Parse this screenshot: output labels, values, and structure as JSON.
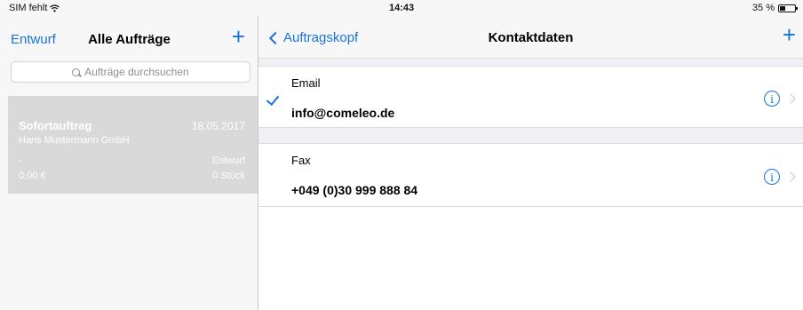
{
  "status_bar": {
    "carrier": "SIM fehlt",
    "time": "14:43",
    "battery": "35 %",
    "battery_level": 0.35
  },
  "left": {
    "back_label": "Entwurf",
    "title": "Alle Aufträge",
    "add_label": "+",
    "search_placeholder": "Aufträge durchsuchen",
    "orders": [
      {
        "name": "Sofortauftrag",
        "date": "18.05.2017",
        "company": "Hans Mustermann GmbH",
        "dash": "-",
        "status": "Entwurf",
        "price": "0,00 €",
        "quantity": "0 Stück"
      }
    ]
  },
  "right": {
    "back_label": "Auftragskopf",
    "title": "Kontaktdaten",
    "add_label": "+",
    "contacts": [
      {
        "label": "Email",
        "value": "info@comeleo.de",
        "selected": true
      },
      {
        "label": "Fax",
        "value": "+049 (0)30 999 888 84",
        "selected": false
      }
    ]
  },
  "colors": {
    "accent": "#1a73d9",
    "selected_row_bg": "#d9d9d9",
    "grouped_bg": "#efeff4"
  }
}
